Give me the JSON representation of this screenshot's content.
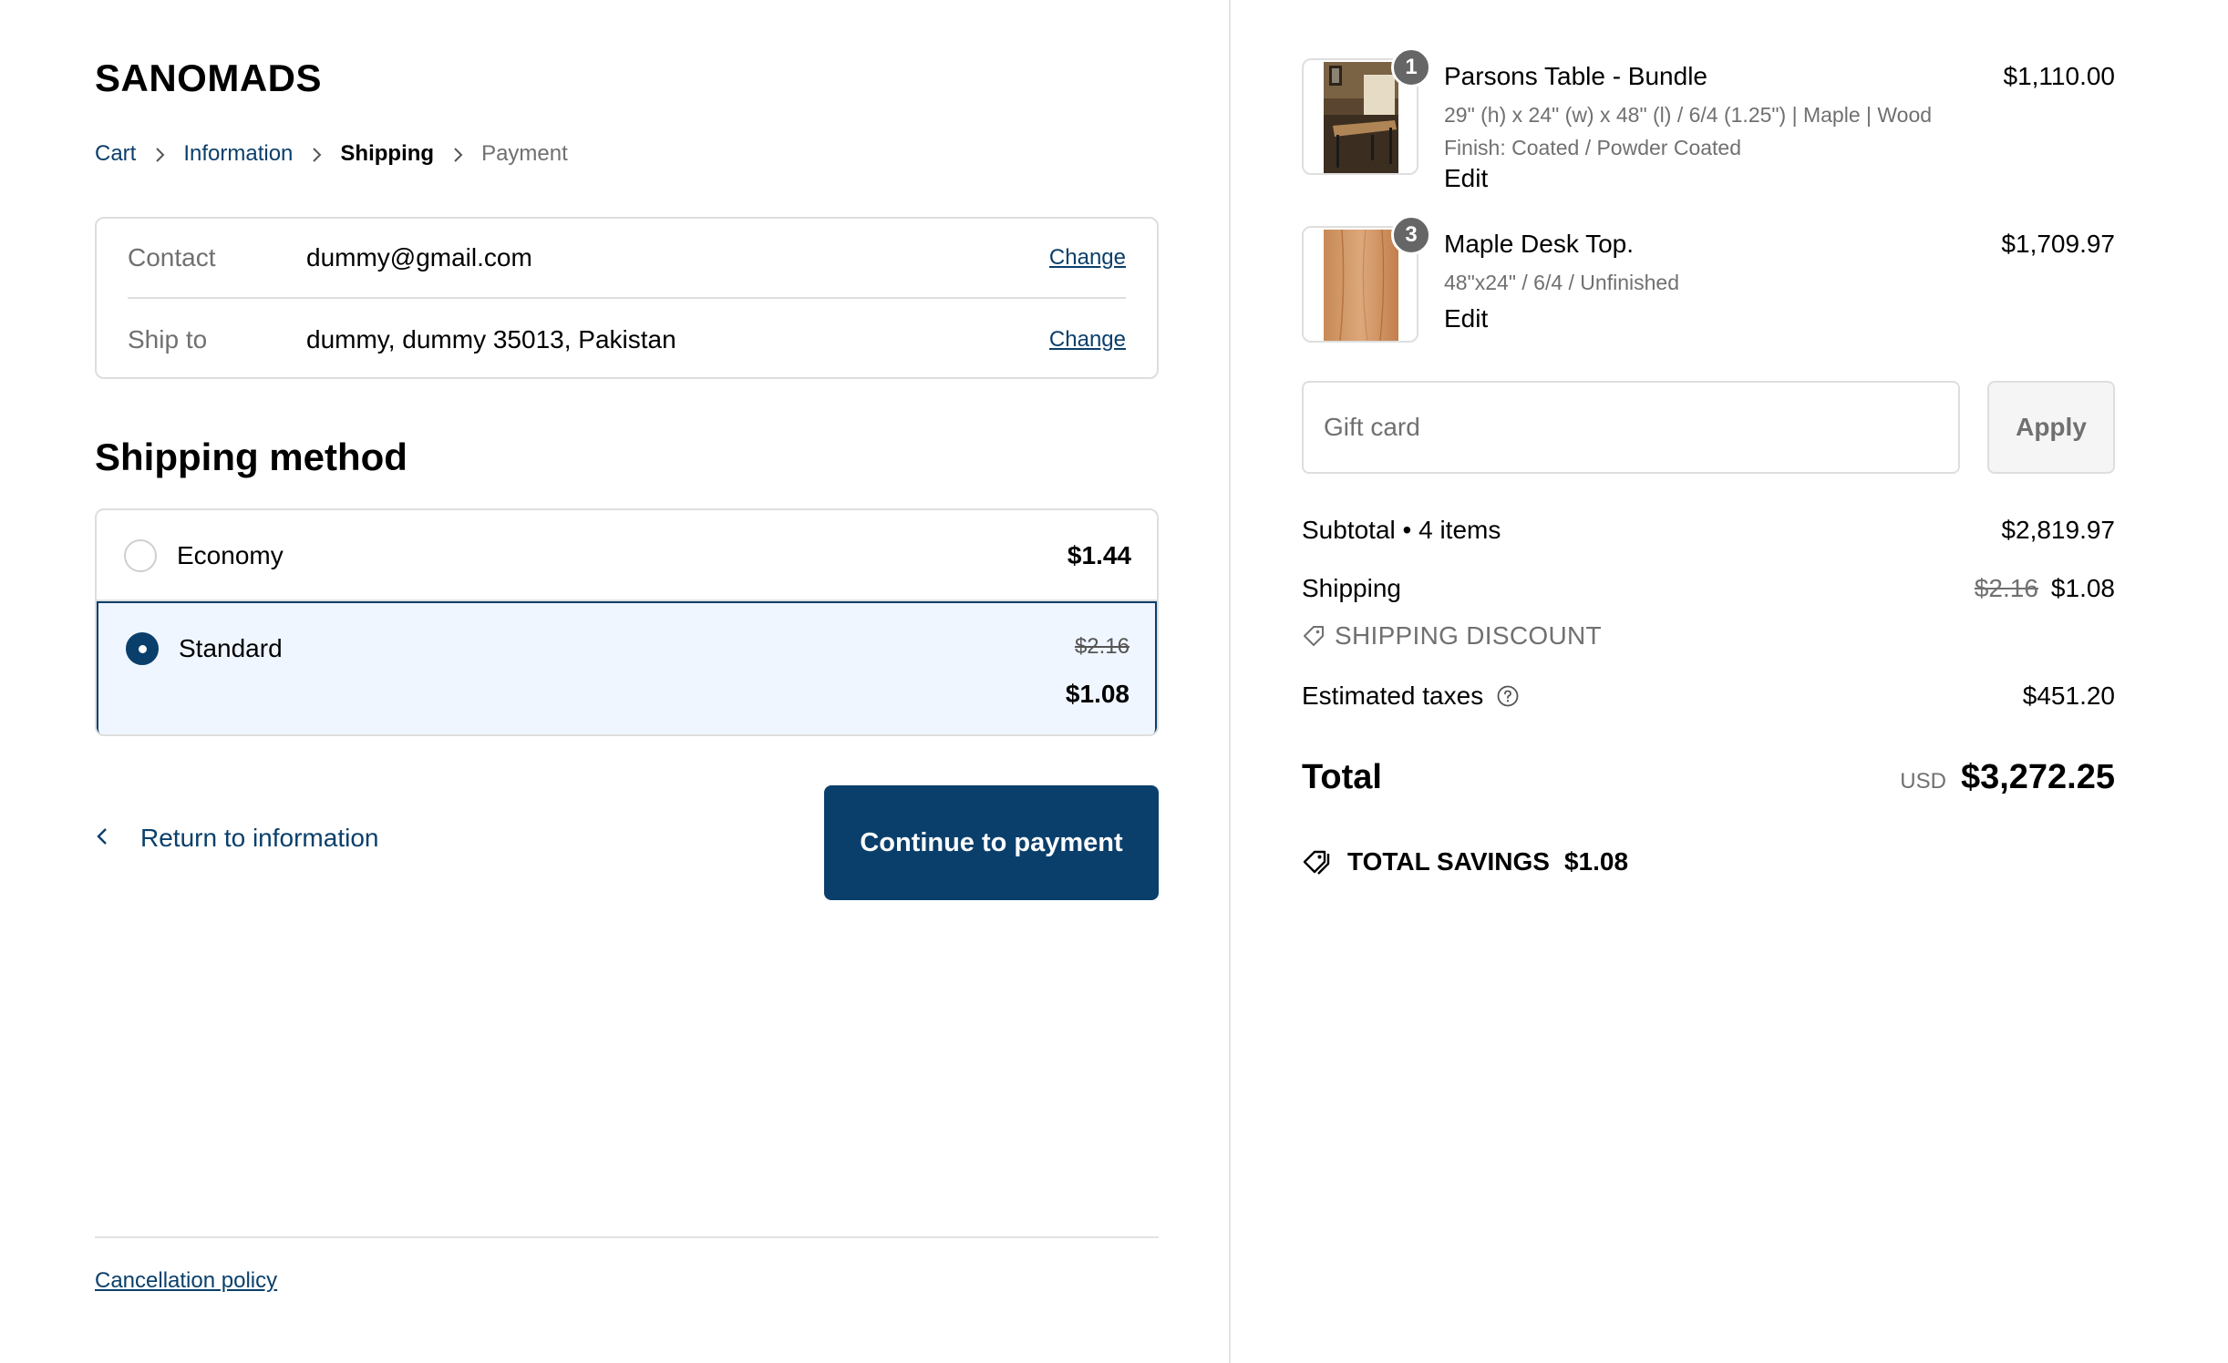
{
  "store": {
    "name": "SANOMADS"
  },
  "breadcrumb": {
    "items": [
      {
        "label": "Cart"
      },
      {
        "label": "Information"
      },
      {
        "label": "Shipping"
      },
      {
        "label": "Payment"
      }
    ]
  },
  "review": {
    "contact": {
      "label": "Contact",
      "value": "dummy@gmail.com",
      "change": "Change"
    },
    "ship_to": {
      "label": "Ship to",
      "value": "dummy, dummy 35013, Pakistan",
      "change": "Change"
    }
  },
  "shipping_method": {
    "title": "Shipping method",
    "options": [
      {
        "label": "Economy",
        "price": "$1.44",
        "selected": false
      },
      {
        "label": "Standard",
        "original_price": "$2.16",
        "price": "$1.08",
        "selected": true
      }
    ]
  },
  "actions": {
    "return_label": "Return to information",
    "continue_label": "Continue to payment"
  },
  "footer": {
    "policy_link": "Cancellation policy"
  },
  "order": {
    "items": [
      {
        "qty": "1",
        "name": "Parsons Table - Bundle",
        "variant": "29\" (h) x 24\" (w) x 48\" (l) / 6/4 (1.25\") | Maple | Wood Finish: Coated / Powder Coated",
        "edit": "Edit",
        "price": "$1,110.00"
      },
      {
        "qty": "3",
        "name": "Maple Desk Top.",
        "variant": "48\"x24\" / 6/4 / Unfinished",
        "edit": "Edit",
        "price": "$1,709.97"
      }
    ],
    "gift_card": {
      "placeholder": "Gift card",
      "apply": "Apply"
    },
    "subtotal": {
      "label": "Subtotal • 4 items",
      "value": "$2,819.97"
    },
    "shipping": {
      "label": "Shipping",
      "original": "$2.16",
      "value": "$1.08"
    },
    "discount": {
      "label": "SHIPPING DISCOUNT"
    },
    "taxes": {
      "label": "Estimated taxes",
      "value": "$451.20"
    },
    "total": {
      "label": "Total",
      "currency": "USD",
      "value": "$3,272.25"
    },
    "savings": {
      "label": "TOTAL SAVINGS",
      "value": "$1.08"
    }
  },
  "colors": {
    "accent": "#0a3f6b",
    "selected_bg": "#f0f6ff",
    "border": "#dedede",
    "muted_text": "#707070"
  }
}
